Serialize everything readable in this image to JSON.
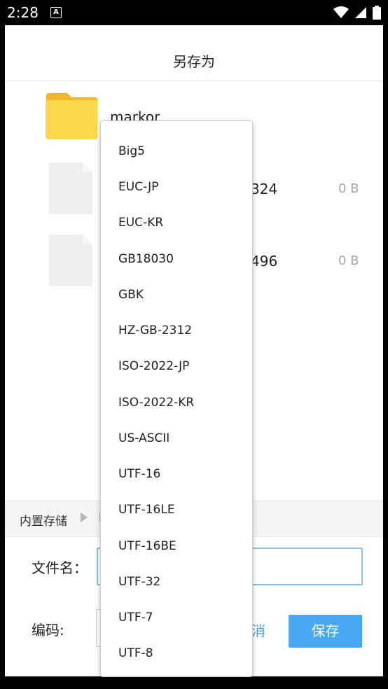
{
  "status_bar": {
    "time": "2:28",
    "notification_icon": "A"
  },
  "dialog": {
    "title": "另存为",
    "files": [
      {
        "name": "markor",
        "type": "folder"
      },
      {
        "name": "324",
        "size": "0 B",
        "type": "file"
      },
      {
        "name": "496",
        "size": "0 B",
        "type": "file"
      }
    ],
    "breadcrumb": {
      "items": [
        "内置存储"
      ],
      "next_glyph": "I"
    },
    "filename_label": "文件名：",
    "encoding_label": "编码:",
    "cancel_label": "消",
    "save_label": "保存"
  },
  "encoding_options": [
    "Big5",
    "EUC-JP",
    "EUC-KR",
    "GB18030",
    "GBK",
    "HZ-GB-2312",
    "ISO-2022-JP",
    "ISO-2022-KR",
    "US-ASCII",
    "UTF-16",
    "UTF-16LE",
    "UTF-16BE",
    "UTF-32",
    "UTF-7",
    "UTF-8"
  ],
  "colors": {
    "accent": "#49a8f4",
    "folder": "#fcd84a",
    "folder_tab": "#f4b529"
  }
}
